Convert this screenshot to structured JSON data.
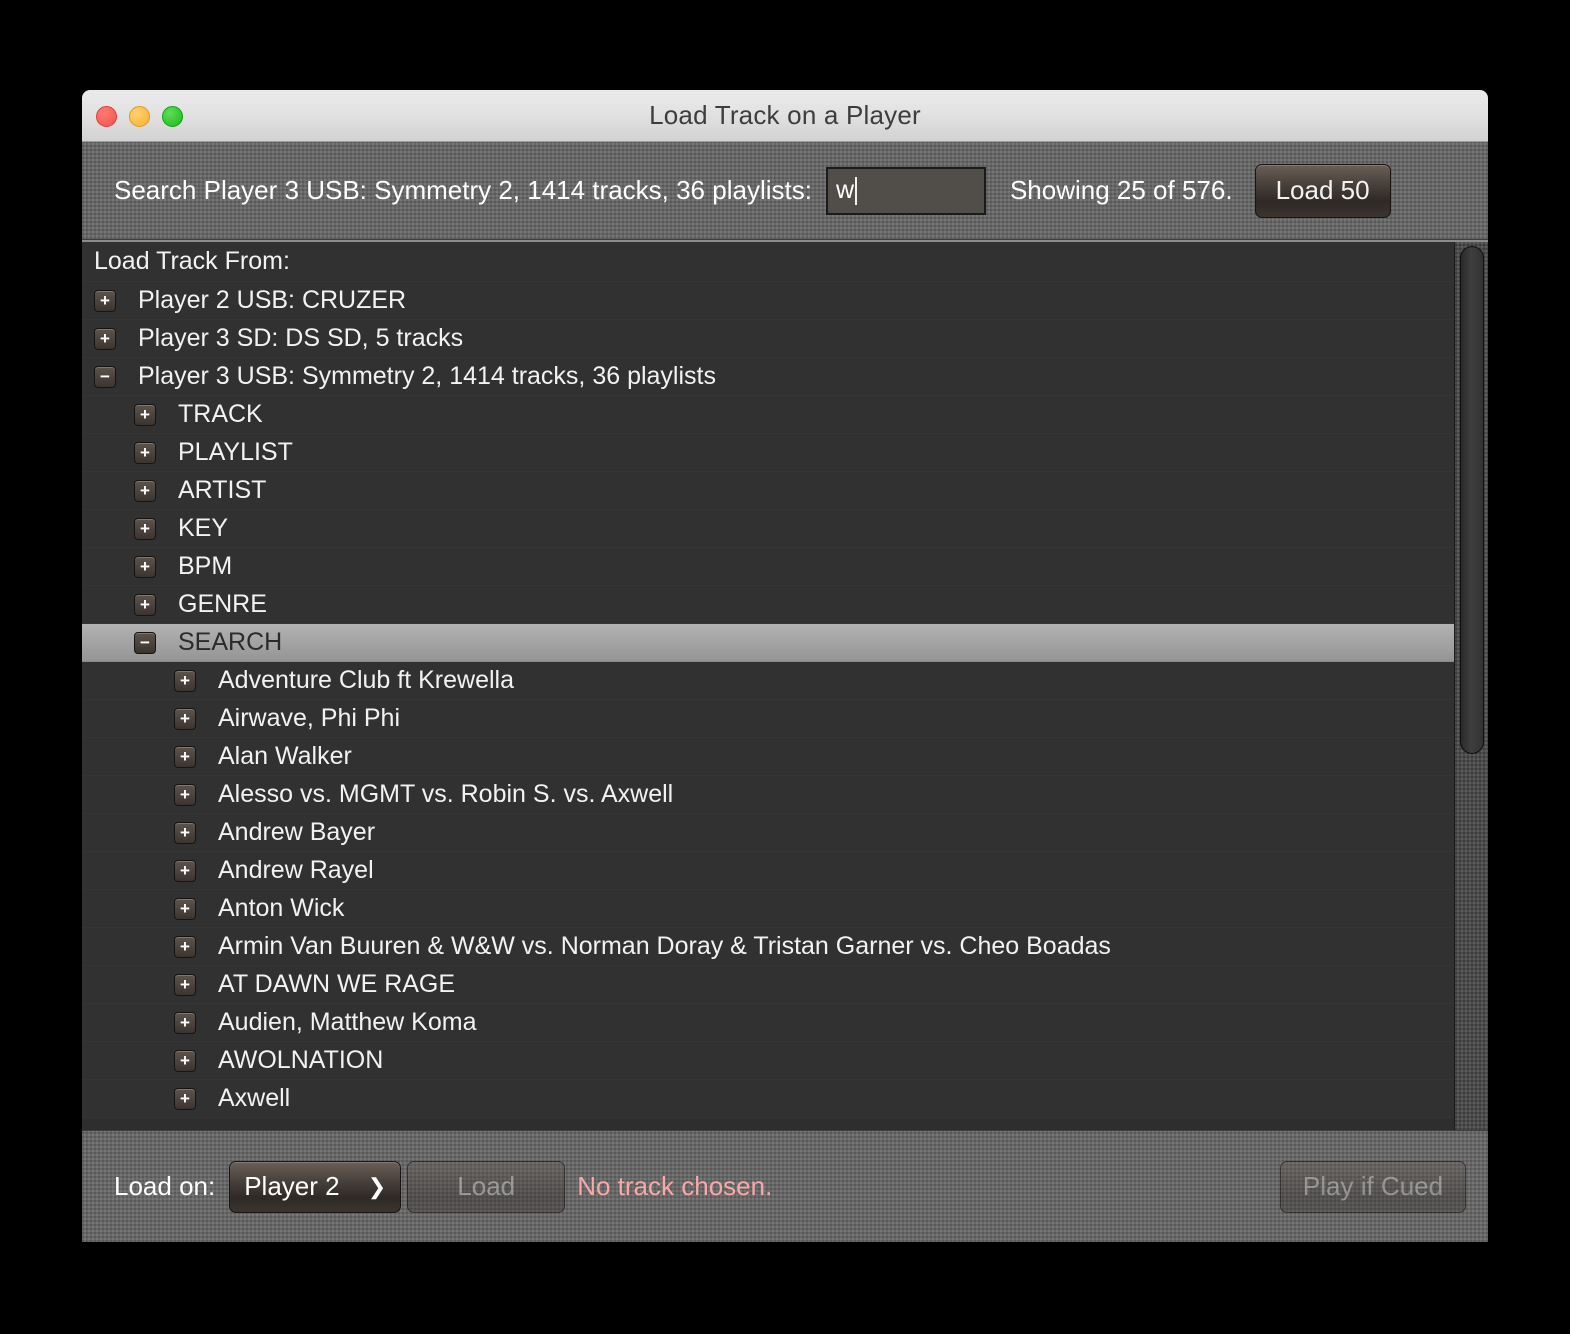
{
  "window": {
    "title": "Load Track on a Player",
    "traffic_lights": [
      {
        "name": "close",
        "color": "#f4514c"
      },
      {
        "name": "minimize",
        "color": "#f9b22b"
      },
      {
        "name": "zoom",
        "color": "#1db81d"
      }
    ]
  },
  "toolbar": {
    "search_label": "Search Player 3 USB: Symmetry 2, 1414 tracks, 36 playlists:",
    "search_value": "w",
    "search_placeholder": "",
    "showing_text": "Showing 25 of 576.",
    "load_more_label": "Load 50"
  },
  "tree": {
    "header": "Load Track From:",
    "rows": [
      {
        "toggle": "+",
        "indent": 1,
        "label": "Player 2 USB: CRUZER",
        "selected": false
      },
      {
        "toggle": "+",
        "indent": 1,
        "label": "Player 3 SD: DS SD, 5 tracks",
        "selected": false
      },
      {
        "toggle": "−",
        "indent": 1,
        "label": "Player 3 USB: Symmetry 2, 1414 tracks, 36 playlists",
        "selected": false
      },
      {
        "toggle": "+",
        "indent": 2,
        "label": "TRACK",
        "selected": false
      },
      {
        "toggle": "+",
        "indent": 2,
        "label": "PLAYLIST",
        "selected": false
      },
      {
        "toggle": "+",
        "indent": 2,
        "label": "ARTIST",
        "selected": false
      },
      {
        "toggle": "+",
        "indent": 2,
        "label": "KEY",
        "selected": false
      },
      {
        "toggle": "+",
        "indent": 2,
        "label": "BPM",
        "selected": false
      },
      {
        "toggle": "+",
        "indent": 2,
        "label": "GENRE",
        "selected": false
      },
      {
        "toggle": "−",
        "indent": 2,
        "label": "SEARCH",
        "selected": true
      },
      {
        "toggle": "+",
        "indent": 3,
        "label": "Adventure Club ft Krewella",
        "selected": false
      },
      {
        "toggle": "+",
        "indent": 3,
        "label": "Airwave, Phi Phi",
        "selected": false
      },
      {
        "toggle": "+",
        "indent": 3,
        "label": "Alan Walker",
        "selected": false
      },
      {
        "toggle": "+",
        "indent": 3,
        "label": "Alesso vs. MGMT vs. Robin S. vs. Axwell",
        "selected": false
      },
      {
        "toggle": "+",
        "indent": 3,
        "label": "Andrew Bayer",
        "selected": false
      },
      {
        "toggle": "+",
        "indent": 3,
        "label": "Andrew Rayel",
        "selected": false
      },
      {
        "toggle": "+",
        "indent": 3,
        "label": "Anton Wick",
        "selected": false
      },
      {
        "toggle": "+",
        "indent": 3,
        "label": "Armin Van Buuren & W&W vs. Norman Doray & Tristan Garner vs. Cheo Boadas",
        "selected": false
      },
      {
        "toggle": "+",
        "indent": 3,
        "label": "AT DAWN WE RAGE",
        "selected": false
      },
      {
        "toggle": "+",
        "indent": 3,
        "label": "Audien, Matthew Koma",
        "selected": false
      },
      {
        "toggle": "+",
        "indent": 3,
        "label": "AWOLNATION",
        "selected": false
      },
      {
        "toggle": "+",
        "indent": 3,
        "label": "Axwell",
        "selected": false
      }
    ]
  },
  "bottombar": {
    "load_on_label": "Load on:",
    "player_selected": "Player 2",
    "player_options": [
      "Player 2"
    ],
    "chevron": "⌄",
    "load_label": "Load",
    "status_text": "No track chosen.",
    "status_color": "#f6a9a9",
    "play_label": "Play if Cued"
  }
}
